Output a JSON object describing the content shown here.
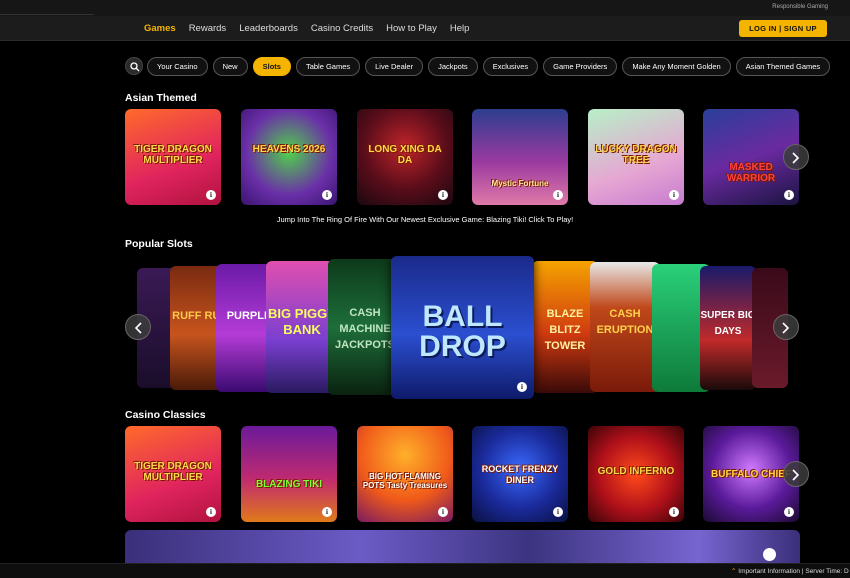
{
  "top_bar": {
    "responsible_gaming": "Responsible Gaming"
  },
  "nav": {
    "items": [
      "Games",
      "Rewards",
      "Leaderboards",
      "Casino Credits",
      "How to Play",
      "Help"
    ],
    "active": "Games",
    "login_label": "LOG IN | SIGN UP"
  },
  "filters": {
    "search_icon": "search-icon",
    "pills": [
      "Your Casino",
      "New",
      "Slots",
      "Table Games",
      "Live Dealer",
      "Jackpots",
      "Exclusives",
      "Game Providers",
      "Make Any Moment Golden",
      "Asian Themed Games"
    ],
    "active": "Slots"
  },
  "sections": {
    "asian_themed": {
      "title": "Asian Themed",
      "games": [
        "TIGER DRAGON MULTIPLIER",
        "HEAVENS 2026",
        "LONG XING DA DA",
        "Mystic Fortune",
        "LUCKY DRAGON TREE",
        "MASKED WARRIOR"
      ]
    },
    "promo_text": "Jump Into The Ring Of Fire With Our Newest Exclusive Game: Blazing Tiki! Click To Play!",
    "popular_slots": {
      "title": "Popular Slots",
      "featured": "BALL DROP",
      "side_titles": [
        "RUFF RUFF",
        "PURPLE",
        "BIG PIGGY BANK",
        "CASH MACHINE JACKPOTS",
        "BLAZE BLITZ TOWER",
        "CASH ERUPTION",
        "SUPER BIG DAYS"
      ]
    },
    "casino_classics": {
      "title": "Casino Classics",
      "games": [
        "TIGER DRAGON MULTIPLIER",
        "BLAZING TIKI",
        "BIG HOT FLAMING POTS Tasty Treasures",
        "ROCKET FRENZY DINER",
        "GOLD INFERNO",
        "BUFFALO CHIEF"
      ]
    }
  },
  "footer": {
    "important": "Important Information",
    "server_time": "| Server Time: D"
  },
  "colors": {
    "accent": "#f5b400",
    "background": "#000000"
  }
}
